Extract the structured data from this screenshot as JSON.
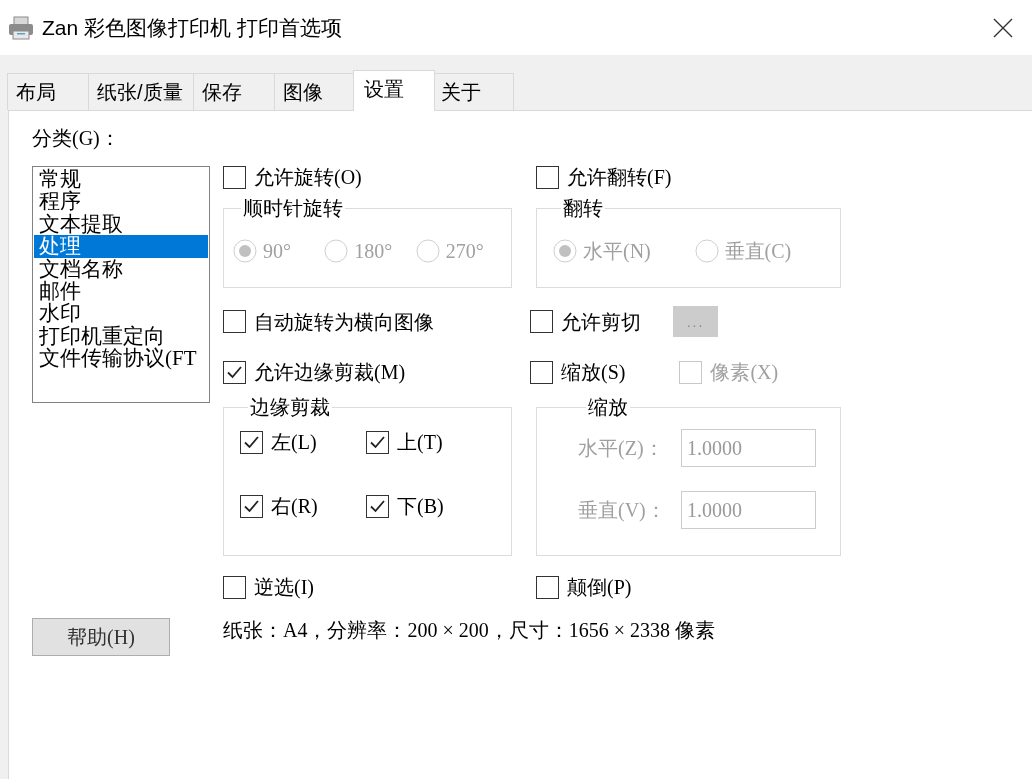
{
  "window": {
    "title": "Zan 彩色图像打印机 打印首选项"
  },
  "tabs": [
    {
      "label": "布局",
      "selected": false
    },
    {
      "label": "纸张/质量",
      "selected": false
    },
    {
      "label": "保存",
      "selected": false
    },
    {
      "label": "图像",
      "selected": false
    },
    {
      "label": "设置",
      "selected": true
    },
    {
      "label": "关于",
      "selected": false
    }
  ],
  "category": {
    "label": "分类(G)：",
    "items": [
      {
        "label": "常规",
        "selected": false
      },
      {
        "label": "程序",
        "selected": false
      },
      {
        "label": "文本提取",
        "selected": false
      },
      {
        "label": "处理",
        "selected": true
      },
      {
        "label": "文档名称",
        "selected": false
      },
      {
        "label": "邮件",
        "selected": false
      },
      {
        "label": "水印",
        "selected": false
      },
      {
        "label": "打印机重定向",
        "selected": false
      },
      {
        "label": "文件传输协议(FT",
        "selected": false
      }
    ]
  },
  "rotation": {
    "checkbox": {
      "label": "允许旋转(O)",
      "checked": false
    },
    "group": {
      "title": "顺时针旋转",
      "disabled": true,
      "options": [
        {
          "label": "90°",
          "selected": true
        },
        {
          "label": "180°",
          "selected": false
        },
        {
          "label": "270°",
          "selected": false
        }
      ]
    }
  },
  "flip": {
    "checkbox": {
      "label": "允许翻转(F)",
      "checked": false
    },
    "group": {
      "title": "翻转",
      "disabled": true,
      "options": [
        {
          "label": "水平(N)",
          "selected": true
        },
        {
          "label": "垂直(C)",
          "selected": false
        }
      ]
    }
  },
  "auto_rotate": {
    "label": "自动旋转为横向图像",
    "checked": false
  },
  "allow_cut": {
    "label": "允许剪切",
    "checked": false,
    "button": {
      "label": "...",
      "disabled": true
    }
  },
  "edge_crop": {
    "checkbox": {
      "label": "允许边缘剪裁(M)",
      "checked": true
    },
    "group": {
      "title": "边缘剪裁",
      "options": [
        {
          "label": "左(L)",
          "checked": true
        },
        {
          "label": "上(T)",
          "checked": true
        },
        {
          "label": "右(R)",
          "checked": true
        },
        {
          "label": "下(B)",
          "checked": true
        }
      ]
    }
  },
  "scale": {
    "checkbox": {
      "label": "缩放(S)",
      "checked": false
    },
    "pixels": {
      "label": "像素(X)",
      "checked": false,
      "disabled": true
    },
    "group": {
      "title": "缩放",
      "disabled": true,
      "fields": [
        {
          "label": "水平(Z)：",
          "value": "1.0000"
        },
        {
          "label": "垂直(V)：",
          "value": "1.0000"
        }
      ]
    }
  },
  "invert": {
    "label": "逆选(I)",
    "checked": false
  },
  "upside_down": {
    "label": "颠倒(P)",
    "checked": false
  },
  "info": "纸张：A4，分辨率：200 × 200，尺寸：1656 × 2338 像素",
  "help_button": {
    "label": "帮助(H)"
  }
}
